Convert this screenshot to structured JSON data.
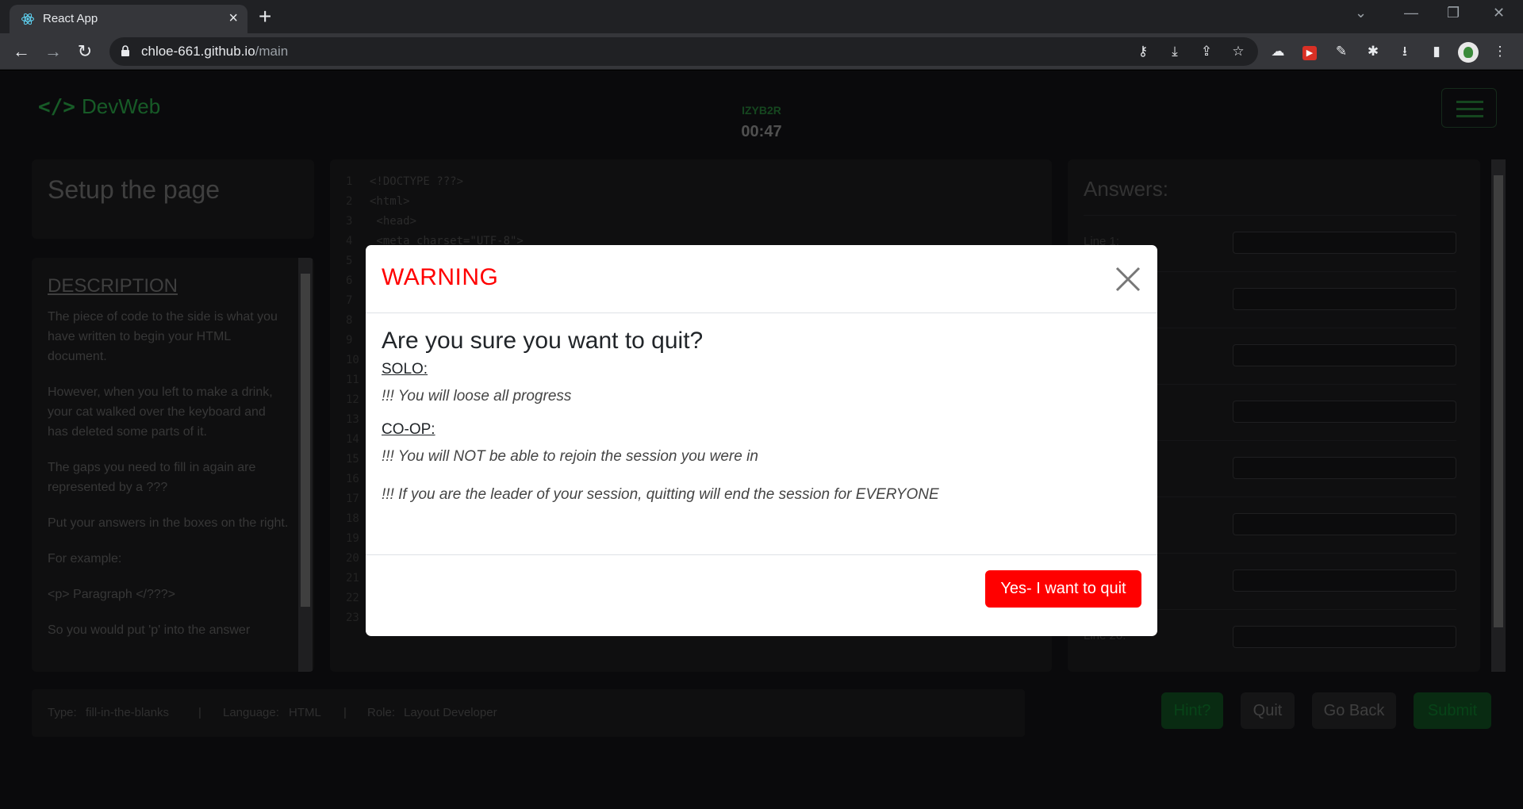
{
  "browser": {
    "tab_title": "React App",
    "url_host": "chloe-661.github.io",
    "url_path": "/main"
  },
  "header": {
    "brand": "DevWeb",
    "brand_icon": "</>",
    "session_code": "IZYB2R",
    "timer": "00:47"
  },
  "task": {
    "title": "Setup the page",
    "description_heading": "DESCRIPTION",
    "description": [
      "The piece of code to the side is what you have written to begin your HTML document.",
      "However, when you left to make a drink, your cat walked over the keyboard and has deleted some parts of it.",
      "The gaps you need to fill in again are represented by a ???",
      "Put your answers in the boxes on the right.",
      "For example:",
      "<p> Paragraph </???>",
      "So you would put 'p' into the answer"
    ]
  },
  "code": {
    "lines": [
      {
        "n": "1",
        "text": "<!DOCTYPE ???>"
      },
      {
        "n": "2",
        "text": "<html>"
      },
      {
        "n": "3",
        "text": "    <head>"
      },
      {
        "n": "4",
        "text": "        <meta charset=\"UTF-8\">"
      },
      {
        "n": "5",
        "text": ""
      },
      {
        "n": "6",
        "text": ""
      },
      {
        "n": "7",
        "text": ""
      },
      {
        "n": "8",
        "text": ""
      },
      {
        "n": "9",
        "text": ""
      },
      {
        "n": "10",
        "text": ""
      },
      {
        "n": "11",
        "text": ""
      },
      {
        "n": "12",
        "text": ""
      },
      {
        "n": "13",
        "text": ""
      },
      {
        "n": "14",
        "text": ""
      },
      {
        "n": "15",
        "text": ""
      },
      {
        "n": "16",
        "text": ""
      },
      {
        "n": "17",
        "text": ""
      },
      {
        "n": "18",
        "text": ""
      },
      {
        "n": "19",
        "text": ""
      },
      {
        "n": "20",
        "text": ""
      },
      {
        "n": "21",
        "text": ""
      },
      {
        "n": "22",
        "text": ""
      },
      {
        "n": "23",
        "text": ""
      }
    ]
  },
  "answers": {
    "title": "Answers:",
    "rows": [
      {
        "label": "Line 1:"
      },
      {
        "label": ""
      },
      {
        "label": ""
      },
      {
        "label": ""
      },
      {
        "label": ""
      },
      {
        "label": ""
      },
      {
        "label": ""
      },
      {
        "label": "Line 20:"
      }
    ]
  },
  "info": {
    "type_label": "Type:",
    "type_value": "fill-in-the-blanks",
    "sep": "|",
    "language_label": "Language:",
    "language_value": "HTML",
    "role_label": "Role:",
    "role_value": "Layout Developer"
  },
  "actions": {
    "hint": "Hint?",
    "quit": "Quit",
    "go_back": "Go Back",
    "submit": "Submit"
  },
  "modal": {
    "title": "WARNING",
    "question": "Are you sure you want to quit?",
    "solo_heading": "SOLO:",
    "solo_warning": "!!! You will loose all progress",
    "coop_heading": "CO-OP:",
    "coop_warning_1": "!!! You will NOT be able to rejoin the session you were in",
    "coop_warning_2": "!!! If you are the leader of your session, quitting will end the session for EVERYONE",
    "confirm_button": "Yes- I want to quit"
  },
  "colors": {
    "warning_red": "#ff0000",
    "brand_green": "#1f7a35"
  }
}
